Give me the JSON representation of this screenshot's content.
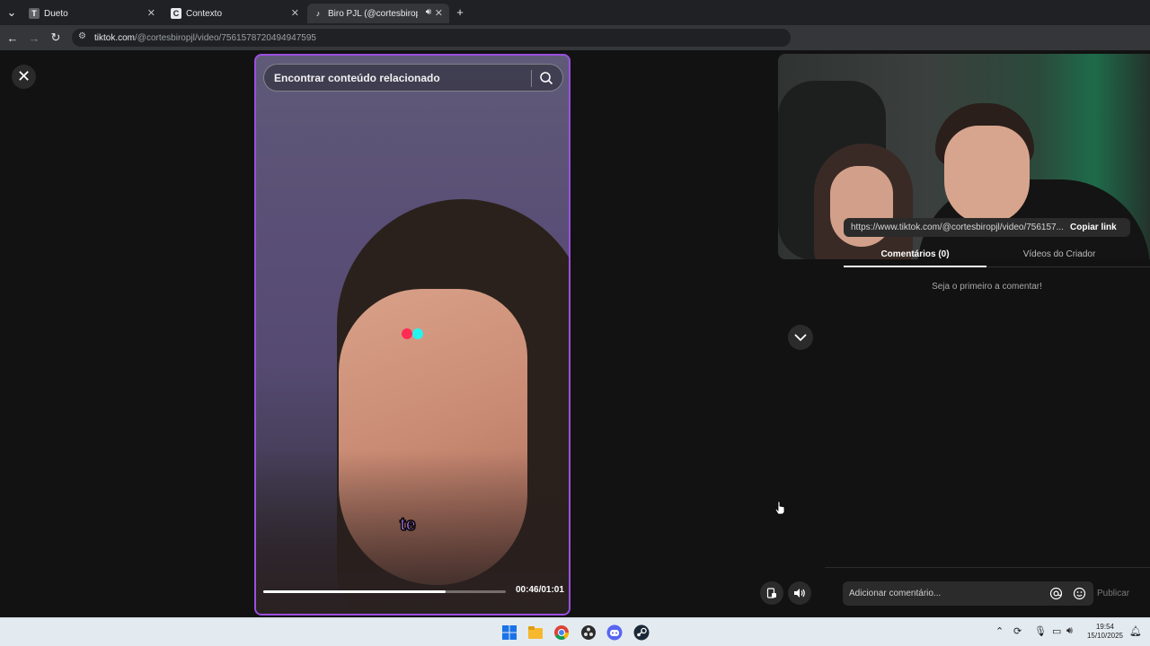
{
  "browser": {
    "tabs": [
      {
        "label": "Dueto",
        "favicon": "T"
      },
      {
        "label": "Contexto",
        "favicon": "C"
      },
      {
        "label": "Biro PJL (@cortesbiropjl) | T"
      }
    ],
    "url_host": "tiktok.com",
    "url_path": "/@cortesbiropjl/video/7561578720494947595"
  },
  "video": {
    "search_placeholder": "Encontrar conteúdo relacionado",
    "caption": "te",
    "progress_fraction": 0.75,
    "timecode": "00:46/01:01"
  },
  "side_panel": {
    "share_url": "https://www.tiktok.com/@cortesbiropjl/video/756157...",
    "copy_label": "Copiar link",
    "tab_comments": "Comentários (0)",
    "tab_creator_videos": "Vídeos do Criador",
    "empty_comments": "Seja o primeiro a comentar!",
    "comment_placeholder": "Adicionar comentário...",
    "publish_label": "Publicar"
  },
  "taskbar": {
    "time": "19:54",
    "date": "15/10/2025"
  },
  "colors": {
    "video_border": "#9b4fe0",
    "tiktok_red": "#fe2c55",
    "tiktok_cyan": "#25f4ee",
    "caption": "#b47cff"
  }
}
